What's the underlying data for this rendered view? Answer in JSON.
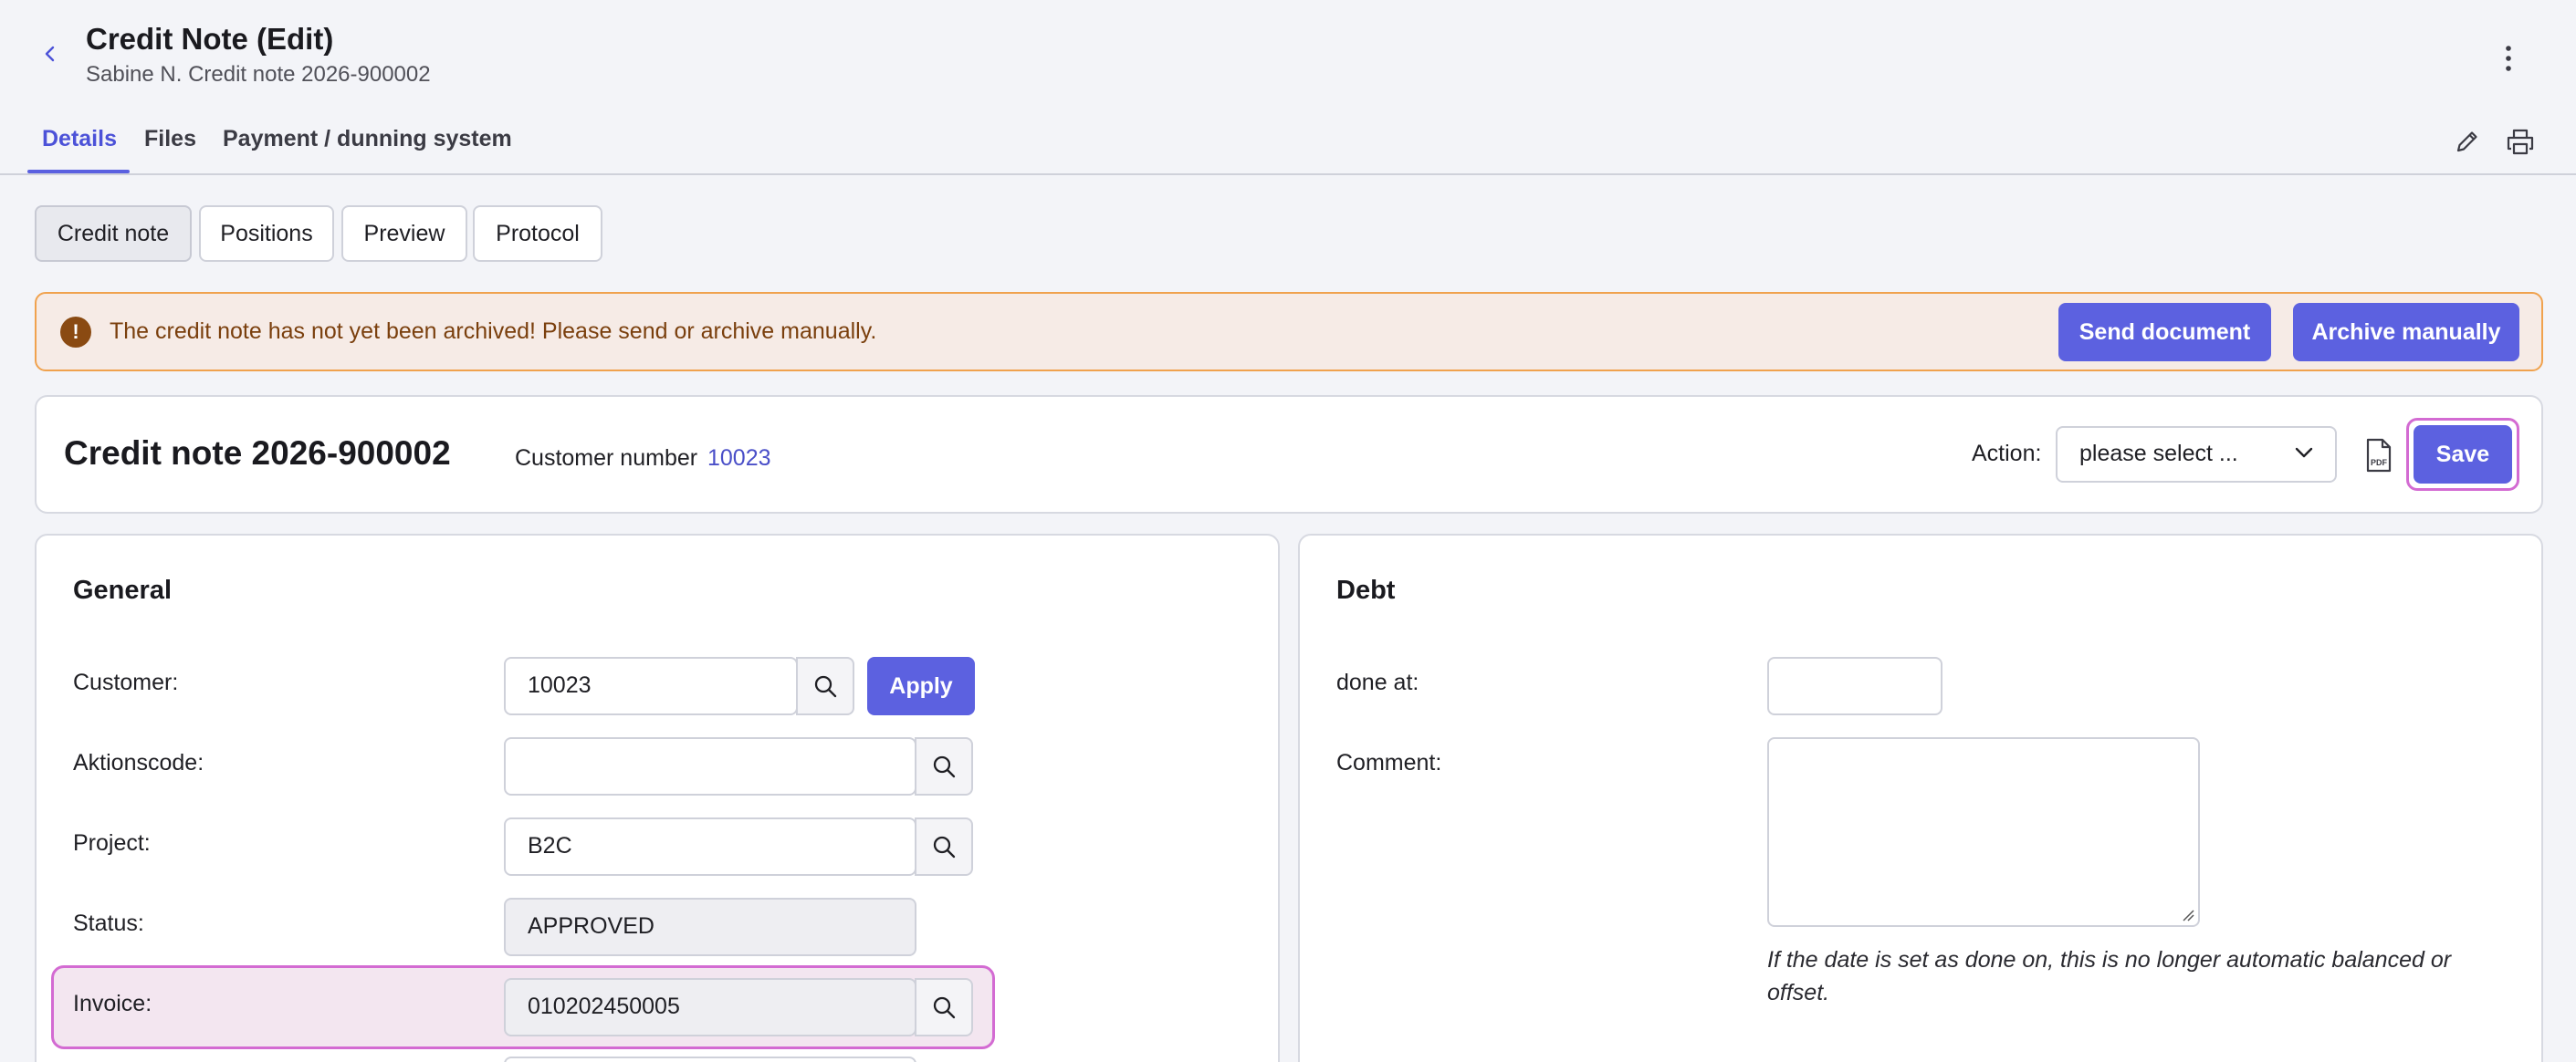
{
  "header": {
    "title": "Credit Note (Edit)",
    "subtitle": "Sabine N. Credit note 2026-900002"
  },
  "tabs": [
    {
      "label": "Details",
      "active": true
    },
    {
      "label": "Files",
      "active": false
    },
    {
      "label": "Payment / dunning system",
      "active": false
    }
  ],
  "subtabs": [
    {
      "label": "Credit note",
      "active": true
    },
    {
      "label": "Positions",
      "active": false
    },
    {
      "label": "Preview",
      "active": false
    },
    {
      "label": "Protocol",
      "active": false
    }
  ],
  "warning": {
    "text": "The credit note has not yet been archived! Please send or archive manually.",
    "icon": "!",
    "send_label": "Send document",
    "archive_label": "Archive manually"
  },
  "credit_note": {
    "title": "Credit note 2026-900002",
    "customer_number_label": "Customer number",
    "customer_number": "10023",
    "action_label": "Action:",
    "action_selected": "please select ...",
    "save_label": "Save"
  },
  "general": {
    "title": "General",
    "customer_label": "Customer:",
    "customer_value": "10023",
    "apply_label": "Apply",
    "aktionscode_label": "Aktionscode:",
    "aktionscode_value": "",
    "project_label": "Project:",
    "project_value": "B2C",
    "status_label": "Status:",
    "status_value": "APPROVED",
    "invoice_label": "Invoice:",
    "invoice_value": "010202450005"
  },
  "debt": {
    "title": "Debt",
    "done_at_label": "done at:",
    "done_at_value": "",
    "comment_label": "Comment:",
    "comment_value": "",
    "hint_line1": "If the date is set as done on, this is no longer automatic balanced or",
    "hint_line2": "offset."
  },
  "colors": {
    "accent": "#5c61e0",
    "warning_bg": "#f6ebe6",
    "warning_border": "#f0a24e",
    "highlight": "#d36bd2"
  }
}
